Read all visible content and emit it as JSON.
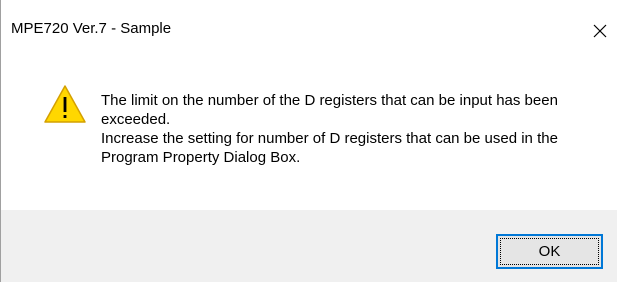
{
  "window": {
    "title": "MPE720 Ver.7 - Sample"
  },
  "icons": {
    "close": "close-icon",
    "warning": "warning-icon"
  },
  "colors": {
    "warning_fill": "#FFD700",
    "warning_border": "#D4A000",
    "button_focus": "#0078D7",
    "footer_bg": "#F0F0F0"
  },
  "message": {
    "line1": "The limit on the number of the D registers that can be input has been exceeded.",
    "line2": "Increase the setting for number of D registers that can be used in the Program Property Dialog Box."
  },
  "buttons": {
    "ok_label": "OK"
  }
}
